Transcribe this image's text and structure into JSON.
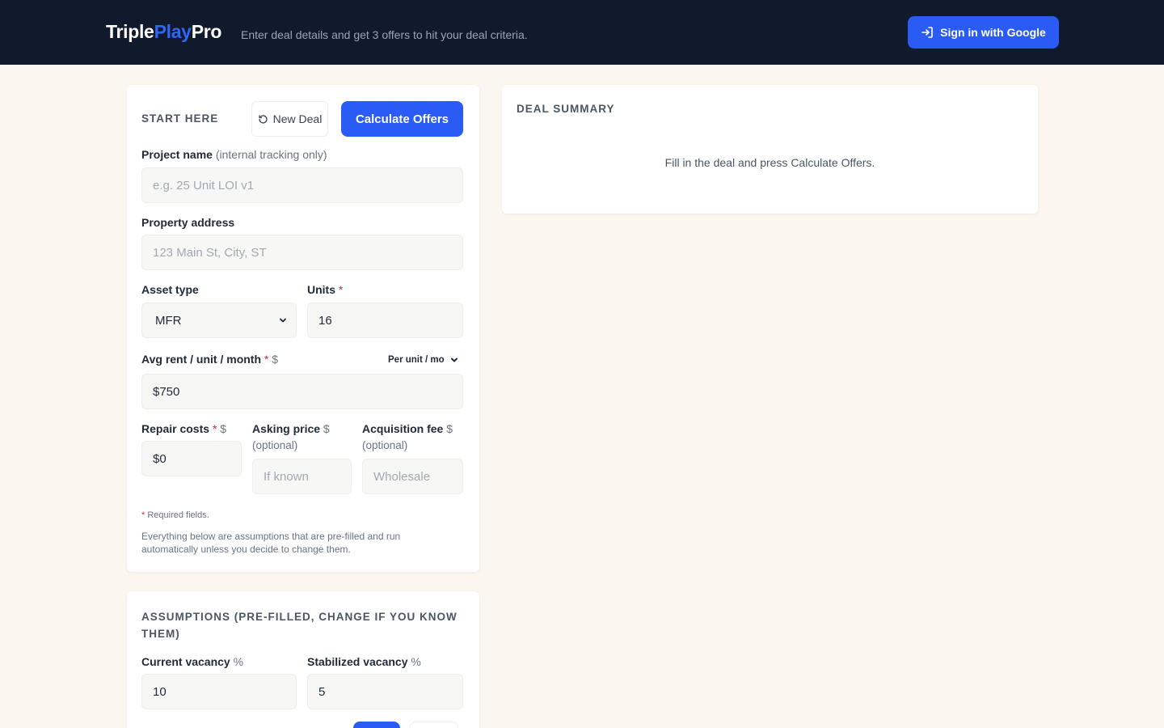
{
  "header": {
    "logo_part1": "Triple",
    "logo_part2": "Play",
    "logo_part3": "Pro",
    "tagline": "Enter deal details and get 3 offers to hit your deal criteria.",
    "signin_label": "Sign in with Google"
  },
  "form": {
    "section_title": "START HERE",
    "new_deal_label": "New Deal",
    "calculate_label": "Calculate Offers",
    "project_name": {
      "label": "Project name",
      "hint": "(internal tracking only)",
      "placeholder": "e.g. 25 Unit LOI v1",
      "value": ""
    },
    "property_address": {
      "label": "Property address",
      "placeholder": "123 Main St, City, ST",
      "value": ""
    },
    "asset_type": {
      "label": "Asset type",
      "value": "MFR"
    },
    "units": {
      "label": "Units",
      "required": "*",
      "value": "16"
    },
    "avg_rent": {
      "label": "Avg rent / unit / month",
      "required": "*",
      "currency": "$",
      "value": "$750",
      "mode": "Per unit / mo"
    },
    "repair_costs": {
      "label": "Repair costs",
      "required": "*",
      "currency": "$",
      "value": "$0"
    },
    "asking_price": {
      "label": "Asking price",
      "currency": "$",
      "hint": "(optional)",
      "placeholder": "If known",
      "value": ""
    },
    "acquisition_fee": {
      "label": "Acquisition fee",
      "currency": "$",
      "hint": "(optional)",
      "placeholder": "Wholesale",
      "value": ""
    },
    "required_marker": "*",
    "required_note": "Required fields.",
    "assumption_note": "Everything below are assumptions that are pre-filled and run automatically unless you decide to change them."
  },
  "assumptions": {
    "section_title_line1": "ASSUMPTIONS (PRE-FILLED, CHANGE IF YOU KNOW",
    "section_title_line2": "THEM)",
    "current_vacancy": {
      "label": "Current vacancy",
      "unit": "%",
      "value": "10"
    },
    "stabilized_vacancy": {
      "label": "Stabilized vacancy",
      "unit": "%",
      "value": "5"
    }
  },
  "summary": {
    "title": "DEAL SUMMARY",
    "empty_message": "Fill in the deal and press Calculate Offers."
  },
  "colors": {
    "header_bg": "#111a2c",
    "accent": "#2a5cf5",
    "page_bg": "#fbf6ef",
    "required": "#e11d48"
  }
}
